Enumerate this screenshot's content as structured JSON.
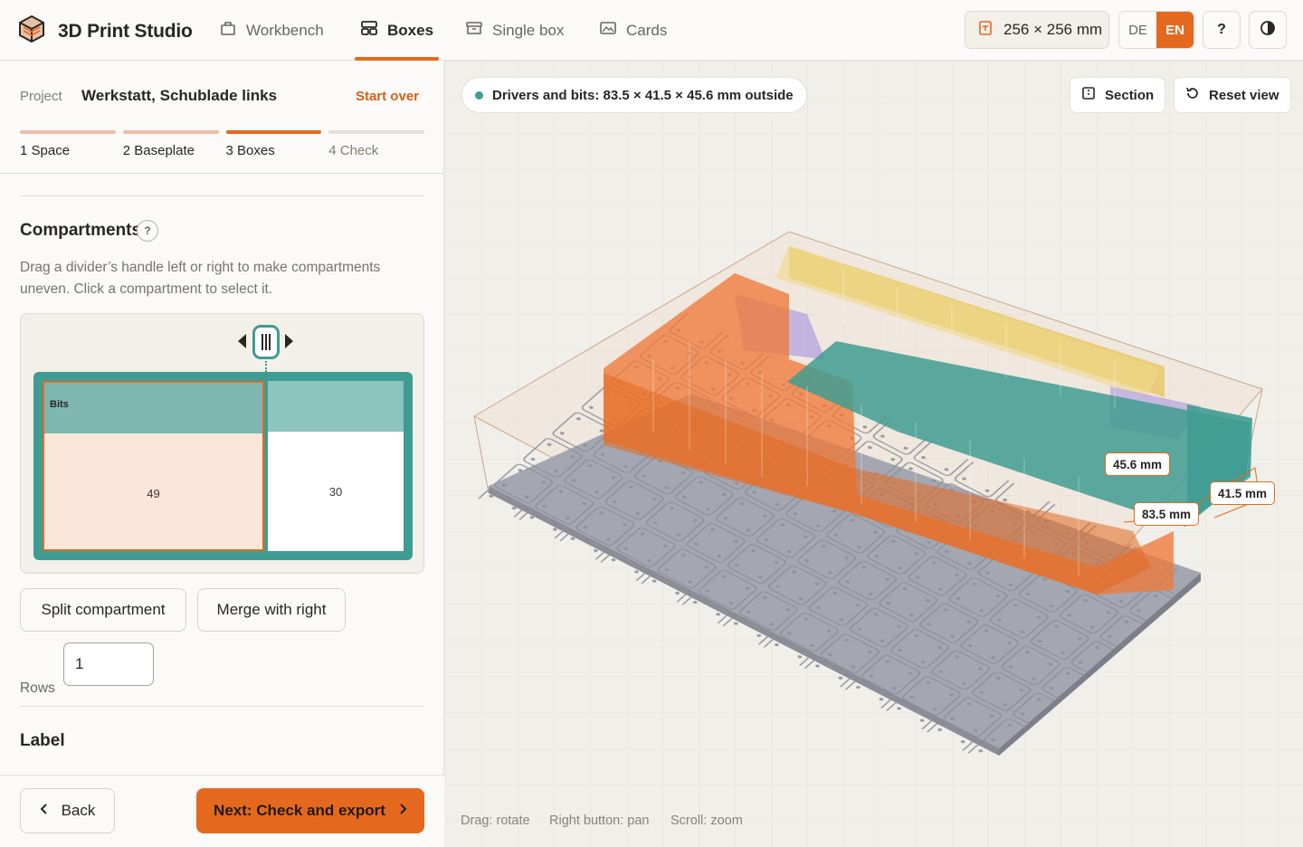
{
  "app": {
    "title": "3D Print Studio"
  },
  "nav": {
    "tabs": [
      {
        "label": "Workbench",
        "icon": "workbench-icon"
      },
      {
        "label": "Boxes",
        "icon": "boxes-icon",
        "active": true
      },
      {
        "label": "Single box",
        "icon": "single-box-icon"
      },
      {
        "label": "Cards",
        "icon": "cards-icon"
      }
    ],
    "plate_size": "256 × 256 mm",
    "lang_de": "DE",
    "lang_en": "EN",
    "lang_active": "EN",
    "help": "?"
  },
  "project": {
    "label": "Project",
    "name": "Werkstatt, Schublade links",
    "start_over": "Start over"
  },
  "steps": [
    {
      "label": "1  Space",
      "state": "done"
    },
    {
      "label": "2  Baseplate",
      "state": "done"
    },
    {
      "label": "3  Boxes",
      "state": "current"
    },
    {
      "label": "4  Check",
      "state": "todo"
    }
  ],
  "compartments": {
    "title": "Compartments",
    "help": "?",
    "description": "Drag a divider’s handle left or right to make compartments uneven. Click a compartment to select it.",
    "items": [
      {
        "label": "Bits",
        "value": "49",
        "selected": true
      },
      {
        "label": "",
        "value": "30",
        "selected": false
      }
    ],
    "split_button": "Split compartment",
    "merge_button": "Merge with right",
    "rows_label": "Rows",
    "rows_value": "1"
  },
  "label_section": {
    "title": "Label"
  },
  "footer": {
    "back": "Back",
    "next": "Next: Check and export"
  },
  "viewport": {
    "selection_chip": "Drivers and bits: 83.5 × 41.5 × 45.6 mm outside",
    "section_button": "Section",
    "reset_button": "Reset view",
    "dim_height": "45.6 mm",
    "dim_depth": "41.5 mm",
    "dim_width": "83.5 mm",
    "hint_drag": "Drag: rotate",
    "hint_pan": "Right button: pan",
    "hint_zoom": "Scroll: zoom"
  },
  "colors": {
    "accent": "#e4691f",
    "teal": "#3f9c92",
    "box_orange": "#ee7a3a",
    "box_yellow": "#e8c86a",
    "box_purple": "#b3a3de",
    "baseplate": "#a4a7b1"
  }
}
